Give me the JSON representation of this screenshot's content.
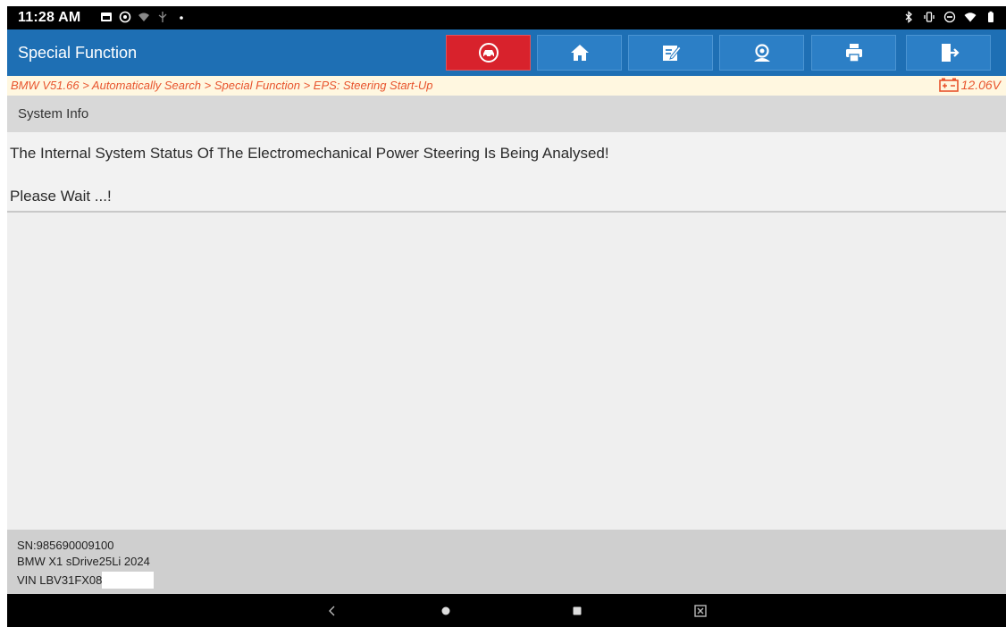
{
  "status_bar": {
    "time": "11:28 AM",
    "left_icons": [
      "image-notification-icon",
      "settings-notification-icon",
      "wifi-notification-icon",
      "usb-icon",
      "dot-icon"
    ],
    "right_icons": [
      "bluetooth-icon",
      "vibrate-icon",
      "do-not-disturb-icon",
      "wifi-icon",
      "battery-icon"
    ]
  },
  "app_bar": {
    "title": "Special Function",
    "buttons": [
      "car-diagnostics-icon",
      "home-icon",
      "edit-report-icon",
      "support-icon",
      "print-icon",
      "exit-icon"
    ]
  },
  "breadcrumb": {
    "path": "BMW V51.66 > Automatically Search > Special Function > EPS: Steering Start-Up",
    "voltage": "12.06V"
  },
  "section": {
    "title": "System Info",
    "message": "The Internal System Status Of The Electromechanical Power Steering Is Being Analysed!",
    "wait": "Please Wait ...!"
  },
  "footer": {
    "sn": "SN:985690009100",
    "vehicle": "BMW X1 sDrive25Li 2024",
    "vin": "VIN LBV31FX08"
  },
  "colors": {
    "app_bar": "#1e6fb4",
    "accent_red": "#d8222c",
    "breadcrumb_text": "#e8542d"
  }
}
